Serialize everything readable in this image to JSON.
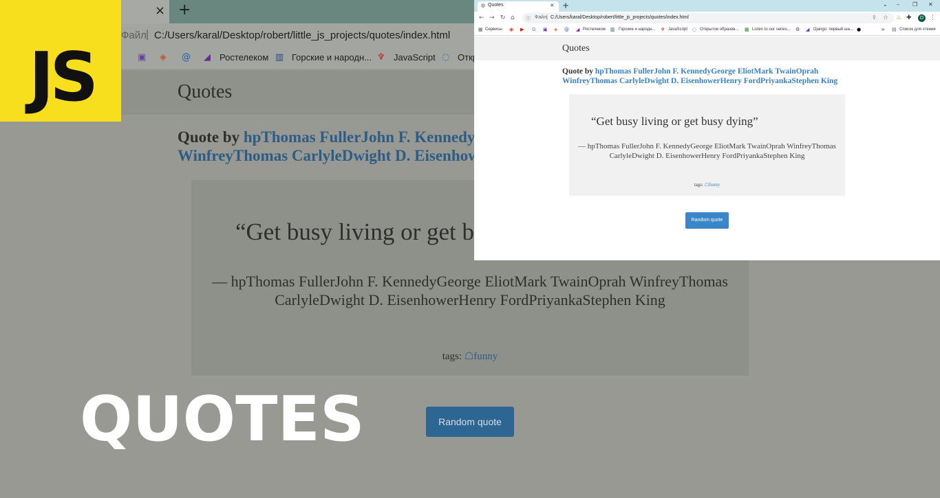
{
  "overlay": {
    "logo_text": "JS",
    "title": "QUOTES",
    "logo_color": "#f7df1e"
  },
  "browser": {
    "tab_title": "Quotes",
    "new_tab": "+",
    "close": "×",
    "window_controls": [
      "⌄",
      "–",
      "❐",
      "✕"
    ],
    "address_prefix": "Файл",
    "url": "C:/Users/karal/Desktop/robert/little_js_projects/quotes/index.html",
    "profile_initial": "D",
    "bookmarks": [
      {
        "icon": "▦",
        "label": "Сервисы"
      },
      {
        "icon": "◉",
        "label": ""
      },
      {
        "icon": "▶",
        "label": ""
      },
      {
        "icon": "G",
        "label": ""
      },
      {
        "icon": "▣",
        "label": ""
      },
      {
        "icon": "◈",
        "label": ""
      },
      {
        "icon": "@",
        "label": ""
      },
      {
        "icon": "◢",
        "label": "Ростелеком"
      },
      {
        "icon": "▥",
        "label": "Горские и народн..."
      },
      {
        "icon": "♆",
        "label": "JavaScript"
      },
      {
        "icon": "◌",
        "label": "Открытое образов..."
      },
      {
        "icon": "▦",
        "label": "Listen to our series..."
      },
      {
        "icon": "⚙",
        "label": ""
      },
      {
        "icon": "◢",
        "label": "Django: первый ша..."
      },
      {
        "icon": "●",
        "label": ""
      }
    ],
    "more_bookmarks": "»",
    "reading_list": "Список для чтения"
  },
  "page": {
    "header_title": "Quotes",
    "quote_by_label": "Quote by ",
    "authors_line1": "hpThomas FullerJohn F. KennedyGeorge EliotMark TwainOprah",
    "authors_line2": "WinfreyThomas CarlyleDwight D. EisenhowerHenry FordPriyankaStephen King",
    "quote_text": "“Get busy living or get busy dying”",
    "author_text": "— hpThomas FullerJohn F. KennedyGeorge EliotMark TwainOprah WinfreyThomas CarlyleDwight D. EisenhowerHenry FordPriyankaStephen King",
    "tags_label": "tags: ",
    "tag": "☖funny",
    "button_label": "Random quote"
  },
  "background": {
    "address_prefix": "Файл",
    "url": "C:/Users/karal/Desktop/robert/little_js_projects/quotes/index.html",
    "header_title": "Quotes",
    "quote_by_label": "Quote by ",
    "authors_line1": "hpThomas FullerJohn F. KennedyGeorge EliotMark TwainOprah",
    "authors_line2": "WinfreyThomas CarlyleDwight D. EisenhowerHenry FordPriyankaStephen King",
    "quote_text": "“Get busy living or get busy dying”",
    "author_text": "— hpThomas FullerJohn F. KennedyGeorge EliotMark TwainOprah WinfreyThomas CarlyleDwight D. EisenhowerHenry FordPriyankaStephen King",
    "tags_label": "tags: ",
    "tag": "☖funny",
    "button_label": "Random quote",
    "bookmarks": [
      {
        "icon": "▣",
        "label": ""
      },
      {
        "icon": "◈",
        "label": ""
      },
      {
        "icon": "@",
        "label": ""
      },
      {
        "icon": "◢",
        "label": "Ростелеком"
      },
      {
        "icon": "▥",
        "label": "Горские и народн..."
      },
      {
        "icon": "♆",
        "label": "JavaScript"
      },
      {
        "icon": "◌",
        "label": "Откр"
      }
    ]
  },
  "colors": {
    "link_blue": "#3a82c4",
    "button_blue": "#3b86c9",
    "tabstrip": "#c4e3eb"
  }
}
